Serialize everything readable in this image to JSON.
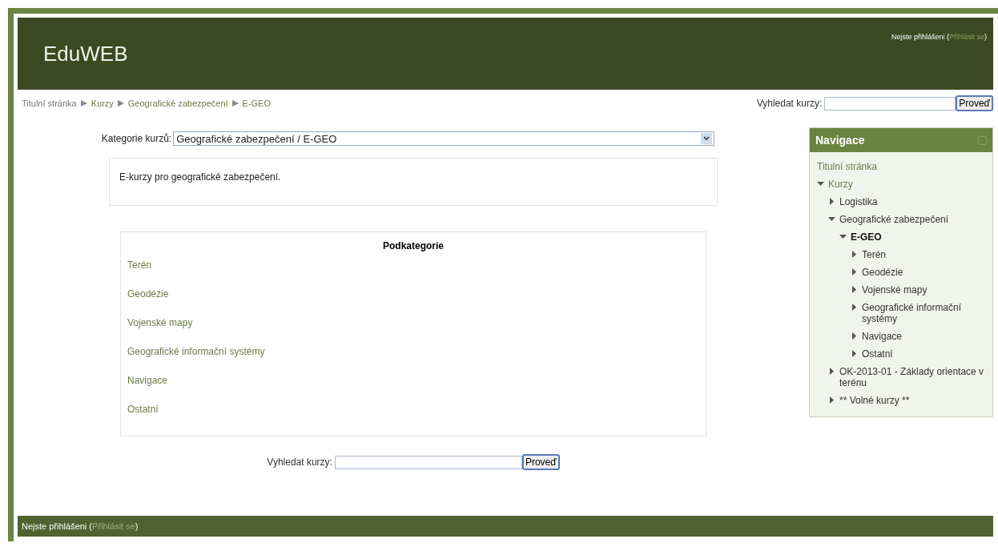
{
  "header": {
    "site_name": "EduWEB",
    "login_info": {
      "text": "Nejste přihlášeni (",
      "link": "Přihlásit se",
      "after": ")"
    }
  },
  "breadcrumb": [
    "Titulní stránka",
    "Kurzy",
    "Geografické zabezpečení",
    "E-GEO"
  ],
  "top_search": {
    "label": "Vyhledat kurzy:",
    "button": "Proveď"
  },
  "category_select": {
    "label": "Kategorie kurzů:",
    "value": "Geografické zabezpečení / E-GEO"
  },
  "description": "E-kurzy pro geografické zabezpečení.",
  "subcategories": {
    "title": "Podkategorie",
    "items": [
      "Terén",
      "Geodézie",
      "Vojenské mapy",
      "Geografické informační systémy",
      "Navigace",
      "Ostatní"
    ]
  },
  "bottom_search": {
    "label": "Vyhledat kurzy:",
    "button": "Proveď"
  },
  "navigation": {
    "title": "Navigace",
    "items": [
      {
        "label": "Titulní stránka",
        "kind": "link"
      },
      {
        "label": "Kurzy",
        "kind": "branch",
        "expanded": true,
        "current": false,
        "children": [
          {
            "label": "Logistika",
            "kind": "branch",
            "expanded": false,
            "current": false
          },
          {
            "label": "Geografické zabezpečení",
            "kind": "branch",
            "expanded": true,
            "current": false,
            "children": [
              {
                "label": "E-GEO",
                "kind": "branch",
                "expanded": true,
                "current": true,
                "children": [
                  {
                    "label": "Terén",
                    "kind": "branch",
                    "expanded": false,
                    "current": false
                  },
                  {
                    "label": "Geodézie",
                    "kind": "branch",
                    "expanded": false,
                    "current": false
                  },
                  {
                    "label": "Vojenské mapy",
                    "kind": "branch",
                    "expanded": false,
                    "current": false
                  },
                  {
                    "label": "Geografické informační systémy",
                    "kind": "branch",
                    "expanded": false,
                    "current": false
                  },
                  {
                    "label": "Navigace",
                    "kind": "branch",
                    "expanded": false,
                    "current": false
                  },
                  {
                    "label": "Ostatní",
                    "kind": "branch",
                    "expanded": false,
                    "current": false
                  }
                ]
              }
            ]
          },
          {
            "label": "OK-2013-01 - Základy orientace v terénu",
            "kind": "branch",
            "expanded": false,
            "current": false
          },
          {
            "label": "** Volné kurzy **",
            "kind": "branch",
            "expanded": false,
            "current": false
          }
        ]
      }
    ]
  },
  "footer": {
    "text": "Nejste přihlášeni (",
    "link": "Přihlásit se",
    "after": ")"
  }
}
